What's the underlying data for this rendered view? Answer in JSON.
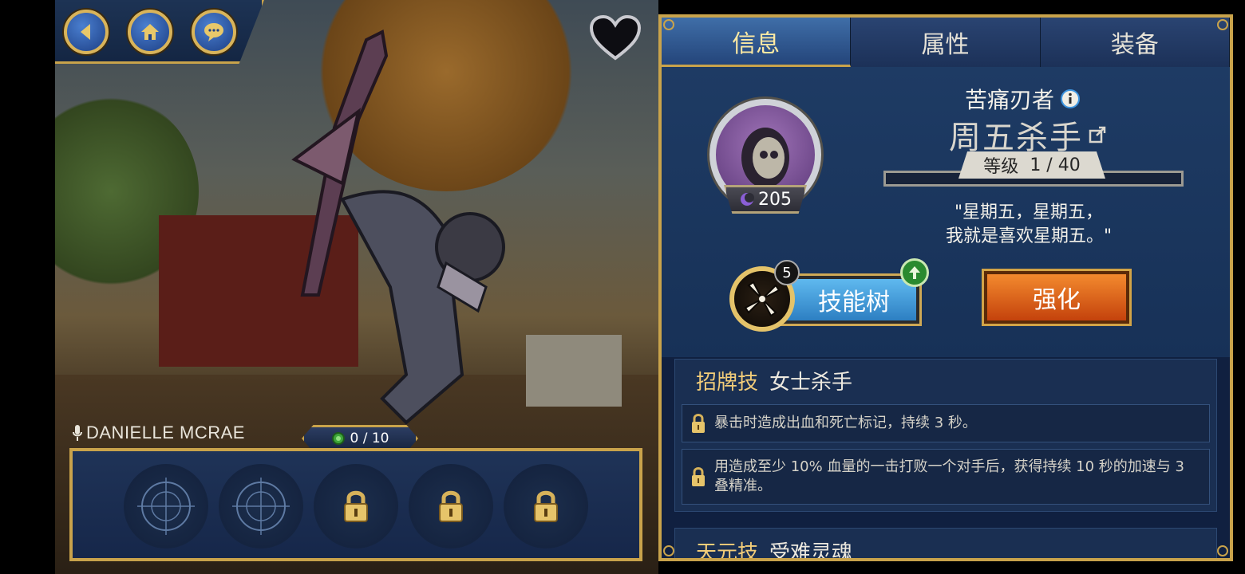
{
  "nav": {
    "back_icon": "back-arrow-icon",
    "home_icon": "home-icon",
    "chat_icon": "chat-bubble-icon",
    "favorite_icon": "heart-icon"
  },
  "character": {
    "voice_actor": "DANIELLE  MCRAE",
    "progress": "0 / 10"
  },
  "slots": [
    "crosshair",
    "crosshair",
    "locked",
    "locked",
    "locked"
  ],
  "tabs": [
    {
      "label": "信息",
      "active": true
    },
    {
      "label": "属性",
      "active": false
    },
    {
      "label": "装备",
      "active": false
    }
  ],
  "info": {
    "subtitle": "苦痛刃者",
    "title": "周五杀手",
    "level_label": "等级",
    "level_value": "1  /  40",
    "rating": "205",
    "quote_line1": "\"星期五，星期五，",
    "quote_line2": "我就是喜欢星期五。\""
  },
  "buttons": {
    "skill_tree": "技能树",
    "skill_tree_count": "5",
    "enhance": "强化"
  },
  "skills": {
    "signature": {
      "label": "招牌技",
      "name": "女士杀手",
      "perks": [
        "暴击时造成出血和死亡标记，持续 3 秒。",
        "用造成至少 10% 血量的一击打败一个对手后，获得持续 10 秒的加速与 3 叠精准。"
      ]
    },
    "innate": {
      "label": "天元技",
      "name": "受难灵魂"
    }
  },
  "colors": {
    "gold": "#c9a34b",
    "panel": "#15294a",
    "skill_blue": "#2d7fc2",
    "enhance_orange": "#c4420c"
  }
}
